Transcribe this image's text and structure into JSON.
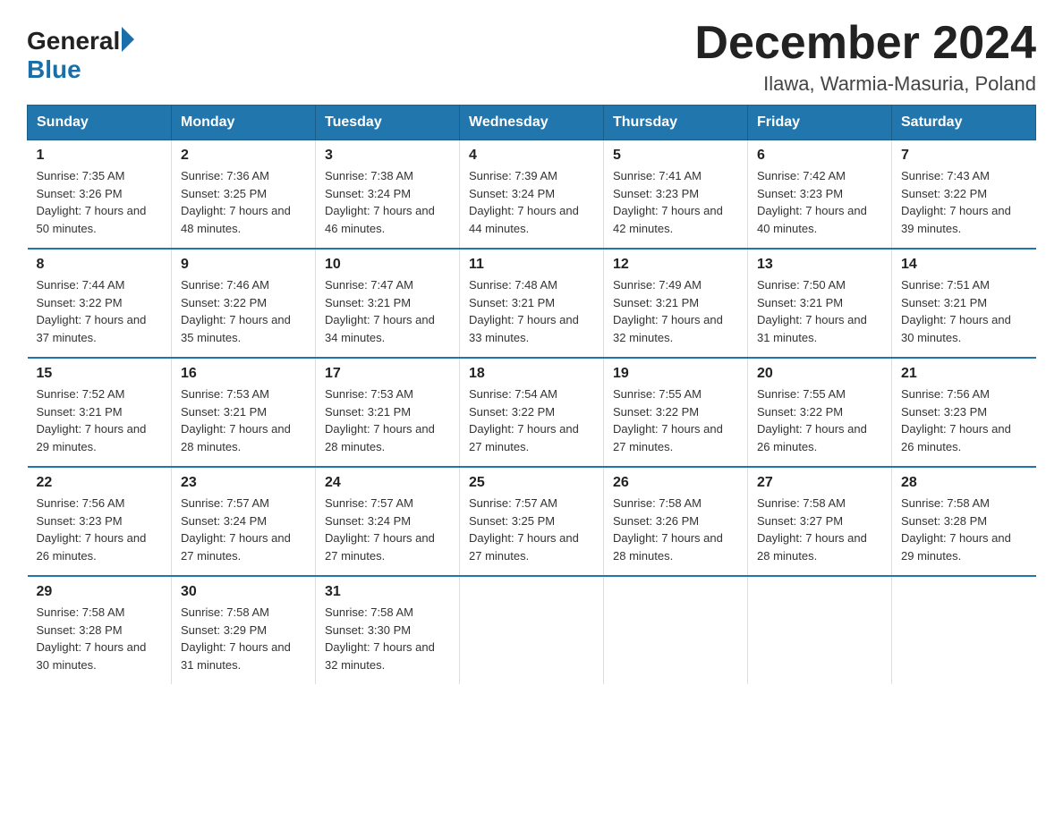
{
  "logo": {
    "general": "General",
    "blue": "Blue"
  },
  "title": "December 2024",
  "location": "Ilawa, Warmia-Masuria, Poland",
  "weekdays": [
    "Sunday",
    "Monday",
    "Tuesday",
    "Wednesday",
    "Thursday",
    "Friday",
    "Saturday"
  ],
  "weeks": [
    [
      {
        "day": "1",
        "sunrise": "7:35 AM",
        "sunset": "3:26 PM",
        "daylight": "7 hours and 50 minutes."
      },
      {
        "day": "2",
        "sunrise": "7:36 AM",
        "sunset": "3:25 PM",
        "daylight": "7 hours and 48 minutes."
      },
      {
        "day": "3",
        "sunrise": "7:38 AM",
        "sunset": "3:24 PM",
        "daylight": "7 hours and 46 minutes."
      },
      {
        "day": "4",
        "sunrise": "7:39 AM",
        "sunset": "3:24 PM",
        "daylight": "7 hours and 44 minutes."
      },
      {
        "day": "5",
        "sunrise": "7:41 AM",
        "sunset": "3:23 PM",
        "daylight": "7 hours and 42 minutes."
      },
      {
        "day": "6",
        "sunrise": "7:42 AM",
        "sunset": "3:23 PM",
        "daylight": "7 hours and 40 minutes."
      },
      {
        "day": "7",
        "sunrise": "7:43 AM",
        "sunset": "3:22 PM",
        "daylight": "7 hours and 39 minutes."
      }
    ],
    [
      {
        "day": "8",
        "sunrise": "7:44 AM",
        "sunset": "3:22 PM",
        "daylight": "7 hours and 37 minutes."
      },
      {
        "day": "9",
        "sunrise": "7:46 AM",
        "sunset": "3:22 PM",
        "daylight": "7 hours and 35 minutes."
      },
      {
        "day": "10",
        "sunrise": "7:47 AM",
        "sunset": "3:21 PM",
        "daylight": "7 hours and 34 minutes."
      },
      {
        "day": "11",
        "sunrise": "7:48 AM",
        "sunset": "3:21 PM",
        "daylight": "7 hours and 33 minutes."
      },
      {
        "day": "12",
        "sunrise": "7:49 AM",
        "sunset": "3:21 PM",
        "daylight": "7 hours and 32 minutes."
      },
      {
        "day": "13",
        "sunrise": "7:50 AM",
        "sunset": "3:21 PM",
        "daylight": "7 hours and 31 minutes."
      },
      {
        "day": "14",
        "sunrise": "7:51 AM",
        "sunset": "3:21 PM",
        "daylight": "7 hours and 30 minutes."
      }
    ],
    [
      {
        "day": "15",
        "sunrise": "7:52 AM",
        "sunset": "3:21 PM",
        "daylight": "7 hours and 29 minutes."
      },
      {
        "day": "16",
        "sunrise": "7:53 AM",
        "sunset": "3:21 PM",
        "daylight": "7 hours and 28 minutes."
      },
      {
        "day": "17",
        "sunrise": "7:53 AM",
        "sunset": "3:21 PM",
        "daylight": "7 hours and 28 minutes."
      },
      {
        "day": "18",
        "sunrise": "7:54 AM",
        "sunset": "3:22 PM",
        "daylight": "7 hours and 27 minutes."
      },
      {
        "day": "19",
        "sunrise": "7:55 AM",
        "sunset": "3:22 PM",
        "daylight": "7 hours and 27 minutes."
      },
      {
        "day": "20",
        "sunrise": "7:55 AM",
        "sunset": "3:22 PM",
        "daylight": "7 hours and 26 minutes."
      },
      {
        "day": "21",
        "sunrise": "7:56 AM",
        "sunset": "3:23 PM",
        "daylight": "7 hours and 26 minutes."
      }
    ],
    [
      {
        "day": "22",
        "sunrise": "7:56 AM",
        "sunset": "3:23 PM",
        "daylight": "7 hours and 26 minutes."
      },
      {
        "day": "23",
        "sunrise": "7:57 AM",
        "sunset": "3:24 PM",
        "daylight": "7 hours and 27 minutes."
      },
      {
        "day": "24",
        "sunrise": "7:57 AM",
        "sunset": "3:24 PM",
        "daylight": "7 hours and 27 minutes."
      },
      {
        "day": "25",
        "sunrise": "7:57 AM",
        "sunset": "3:25 PM",
        "daylight": "7 hours and 27 minutes."
      },
      {
        "day": "26",
        "sunrise": "7:58 AM",
        "sunset": "3:26 PM",
        "daylight": "7 hours and 28 minutes."
      },
      {
        "day": "27",
        "sunrise": "7:58 AM",
        "sunset": "3:27 PM",
        "daylight": "7 hours and 28 minutes."
      },
      {
        "day": "28",
        "sunrise": "7:58 AM",
        "sunset": "3:28 PM",
        "daylight": "7 hours and 29 minutes."
      }
    ],
    [
      {
        "day": "29",
        "sunrise": "7:58 AM",
        "sunset": "3:28 PM",
        "daylight": "7 hours and 30 minutes."
      },
      {
        "day": "30",
        "sunrise": "7:58 AM",
        "sunset": "3:29 PM",
        "daylight": "7 hours and 31 minutes."
      },
      {
        "day": "31",
        "sunrise": "7:58 AM",
        "sunset": "3:30 PM",
        "daylight": "7 hours and 32 minutes."
      },
      null,
      null,
      null,
      null
    ]
  ],
  "labels": {
    "sunrise": "Sunrise:",
    "sunset": "Sunset:",
    "daylight": "Daylight:"
  }
}
